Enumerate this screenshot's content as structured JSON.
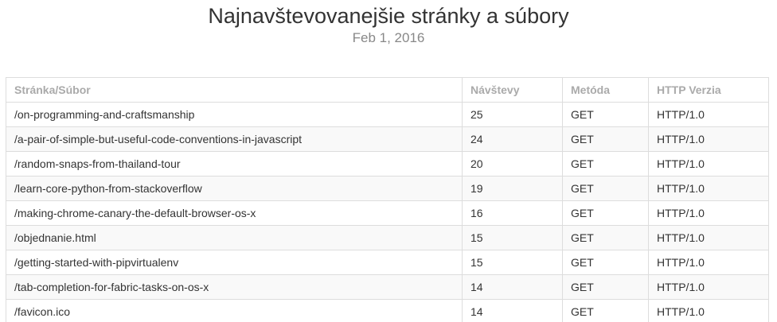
{
  "header": {
    "title": "Najnavštevovanejšie stránky a súbory",
    "date": "Feb 1, 2016"
  },
  "table": {
    "columns": [
      "Stránka/Súbor",
      "Návštevy",
      "Metóda",
      "HTTP Verzia"
    ],
    "rows": [
      [
        "/on-programming-and-craftsmanship",
        "25",
        "GET",
        "HTTP/1.0"
      ],
      [
        "/a-pair-of-simple-but-useful-code-conventions-in-javascript",
        "24",
        "GET",
        "HTTP/1.0"
      ],
      [
        "/random-snaps-from-thailand-tour",
        "20",
        "GET",
        "HTTP/1.0"
      ],
      [
        "/learn-core-python-from-stackoverflow",
        "19",
        "GET",
        "HTTP/1.0"
      ],
      [
        "/making-chrome-canary-the-default-browser-os-x",
        "16",
        "GET",
        "HTTP/1.0"
      ],
      [
        "/objednanie.html",
        "15",
        "GET",
        "HTTP/1.0"
      ],
      [
        "/getting-started-with-pipvirtualenv",
        "15",
        "GET",
        "HTTP/1.0"
      ],
      [
        "/tab-completion-for-fabric-tasks-on-os-x",
        "14",
        "GET",
        "HTTP/1.0"
      ],
      [
        "/favicon.ico",
        "14",
        "GET",
        "HTTP/1.0"
      ]
    ]
  }
}
